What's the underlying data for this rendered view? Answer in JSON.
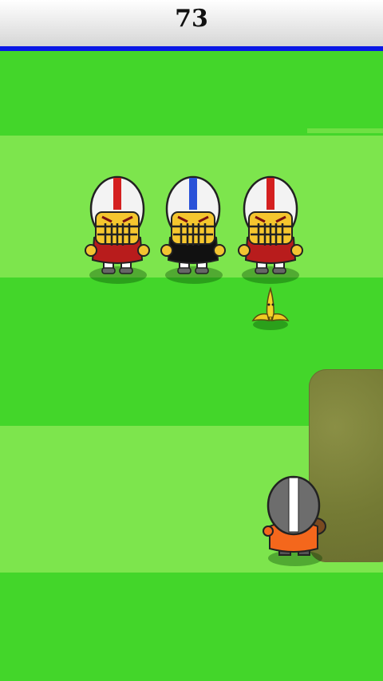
{
  "hud": {
    "score": "73"
  },
  "colors": {
    "field_dark": "#43d62a",
    "field_light": "#7de54d",
    "hud_bar": "#0a17e6",
    "mud": "#7a7f38"
  },
  "defenders": [
    {
      "jersey": "red",
      "helmet_stripe": "red"
    },
    {
      "jersey": "black",
      "helmet_stripe": "blue"
    },
    {
      "jersey": "red",
      "helmet_stripe": "red"
    }
  ],
  "player": {
    "jersey": "orange",
    "helmet": "gray"
  },
  "obstacles": [
    "banana-peel",
    "mud-patch"
  ]
}
